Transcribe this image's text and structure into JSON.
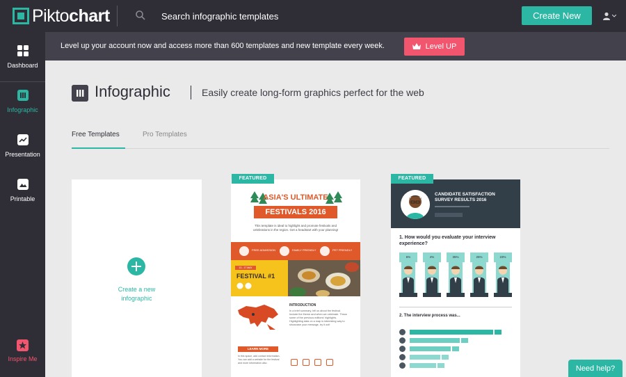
{
  "topbar": {
    "logo_regular": "Pikto",
    "logo_bold": "chart",
    "search_placeholder": "Search infographic templates",
    "create_new": "Create New"
  },
  "sidebar": {
    "items": [
      {
        "label": "Dashboard",
        "icon": "grid-icon"
      },
      {
        "label": "Infographic",
        "icon": "infographic-icon"
      },
      {
        "label": "Presentation",
        "icon": "trend-chart-icon"
      },
      {
        "label": "Printable",
        "icon": "image-icon"
      }
    ],
    "inspire": "Inspire Me"
  },
  "banner": {
    "text": "Level up your account now and access more than 600 templates and new template every week.",
    "button": "Level UP"
  },
  "page": {
    "title": "Infographic",
    "subtitle": "Easily create long-form graphics perfect for the web"
  },
  "tabs": [
    {
      "label": "Free Templates",
      "active": true
    },
    {
      "label": "Pro Templates",
      "active": false
    }
  ],
  "new_card": {
    "label": "Create a new\ninfographic"
  },
  "templates": [
    {
      "badge": "FEATURED",
      "title_line1": "ASIA'S ULTIMATE",
      "title_line2": "FESTIVALS 2016",
      "desc": "This template is ideal to highlight and promote festivals and celebrations in the region. Get a headstart with your planning!",
      "band_items": [
        "FREE ADMISSION",
        "FAMILY FRIENDLY",
        "PET FRIENDLY"
      ],
      "date": "13 - 17 MAY",
      "festival": "FESTIVAL #1",
      "intro_title": "INTRODUCTION",
      "intro_text": "In a brief summary, tell us about the festival. Include the theme and when we celebrate. Throw some of the previous editions' highlights. Highlighting data on a map is interesting way to showcase your message, try it out!",
      "learn_more": "LEARN MORE",
      "foot_text": "In this space, add contact information. You can add a website for the festival and more information also."
    },
    {
      "badge": "FEATURED",
      "title": "CANDIDATE SATISFACTION SURVEY RESULTS 2016",
      "q1": "1. How would you evaluate your interview experience?",
      "q1_values": [
        "6%",
        "4%",
        "35%",
        "25%",
        "23%"
      ],
      "q2": "2. The interview process was...",
      "q2_values": [
        92,
        55,
        45,
        34,
        29
      ]
    }
  ],
  "help": "Need help?",
  "colors": {
    "accent": "#2bb7a4",
    "dark": "#2f2d36",
    "banner": "#43414c",
    "pink": "#f2566e",
    "orange": "#e0592a"
  }
}
